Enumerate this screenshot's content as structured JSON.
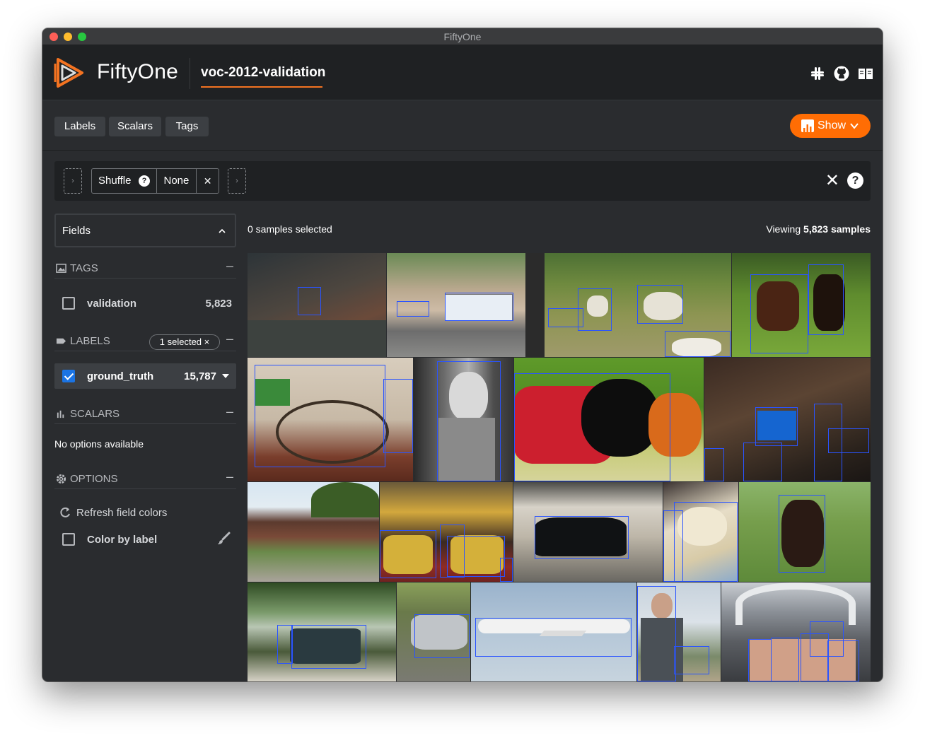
{
  "window": {
    "title": "FiftyOne"
  },
  "header": {
    "brand": "FiftyOne",
    "dataset_name": "voc-2012-validation",
    "icons": [
      "slack-icon",
      "github-icon",
      "docs-book-icon"
    ]
  },
  "subbar": {
    "tabs": [
      {
        "label": "Labels"
      },
      {
        "label": "Scalars"
      },
      {
        "label": "Tags"
      }
    ],
    "show_button": "Show"
  },
  "view_bar": {
    "stage_name": "Shuffle",
    "stage_value": "None",
    "close_glyph": "✕",
    "help_glyph": "?"
  },
  "sidebar": {
    "fields_label": "Fields",
    "tags": {
      "title": "TAGS",
      "items": [
        {
          "label": "validation",
          "count": "5,823",
          "checked": false
        }
      ]
    },
    "labels": {
      "title": "LABELS",
      "selected_pill": "1 selected ×",
      "items": [
        {
          "label": "ground_truth",
          "count": "15,787",
          "checked": true
        }
      ]
    },
    "scalars": {
      "title": "SCALARS",
      "empty": "No options available"
    },
    "options": {
      "title": "OPTIONS",
      "refresh_label": "Refresh field colors",
      "color_by_label": "Color by label"
    }
  },
  "main": {
    "samples_selected": "0 samples selected",
    "viewing_prefix": "Viewing ",
    "viewing_count": "5,823 samples"
  },
  "colors": {
    "accent": "#ff6d04",
    "underline": "#f37321",
    "bbox": "#2a54ff",
    "checkbox": "#1b74e4"
  }
}
